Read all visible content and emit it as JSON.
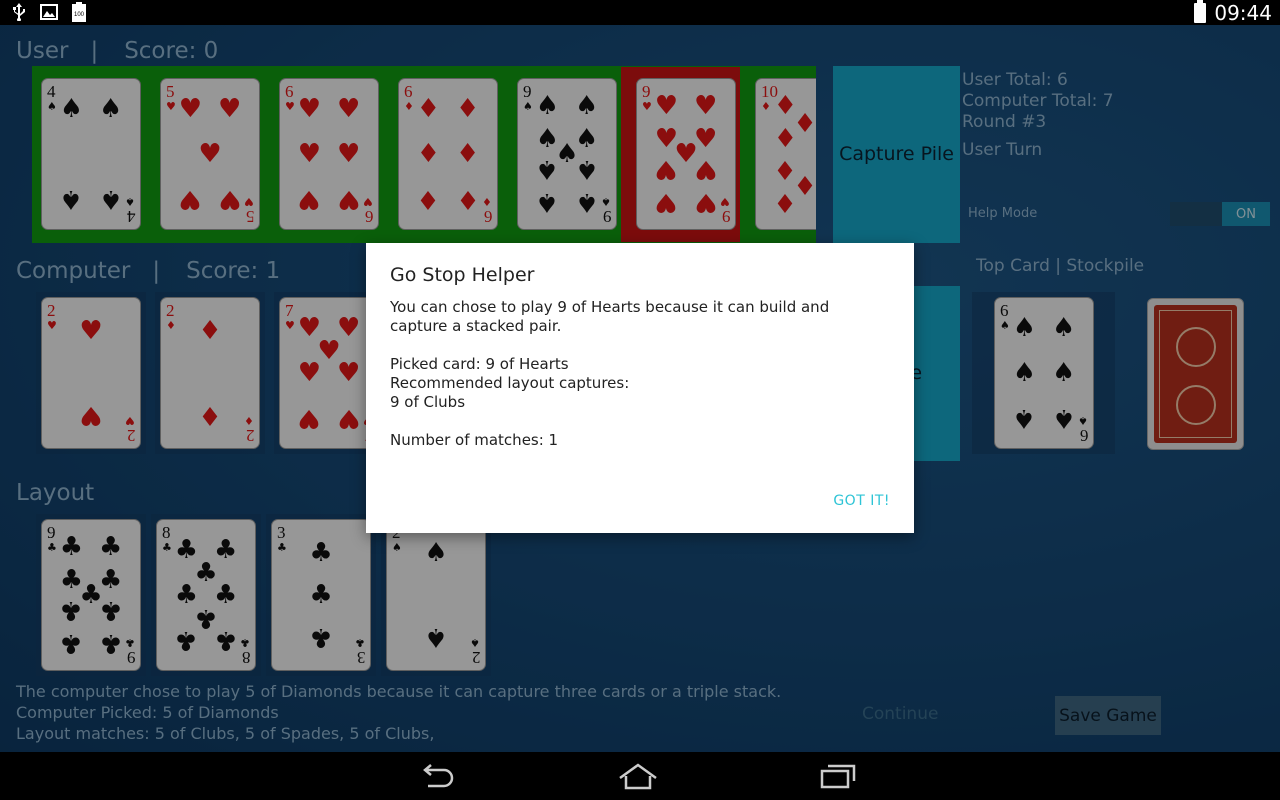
{
  "status_bar": {
    "time": "09:44",
    "icons": [
      "usb-icon",
      "image-icon",
      "battery-100-icon"
    ],
    "battery_label": "100"
  },
  "user": {
    "label": "User",
    "score_label": "Score: 0"
  },
  "computer": {
    "label": "Computer",
    "score_label": "Score: 1"
  },
  "layout_label": "Layout",
  "top_card_label": "Top Card | Stockpile",
  "capture_pile_label": "Capture Pile",
  "capture_pile_label_2": "re",
  "info": {
    "user_total": "User Total: 6",
    "computer_total": "Computer Total: 7",
    "round": "Round #3",
    "turn": "User Turn"
  },
  "help_mode": {
    "label": "Help Mode",
    "state": "ON"
  },
  "user_hand": [
    {
      "rank": "4",
      "suit": "spades"
    },
    {
      "rank": "5",
      "suit": "hearts"
    },
    {
      "rank": "6",
      "suit": "hearts"
    },
    {
      "rank": "6",
      "suit": "diamonds"
    },
    {
      "rank": "9",
      "suit": "spades"
    },
    {
      "rank": "9",
      "suit": "hearts",
      "selected": true
    },
    {
      "rank": "10",
      "suit": "diamonds"
    }
  ],
  "computer_hand": [
    {
      "rank": "2",
      "suit": "hearts"
    },
    {
      "rank": "2",
      "suit": "diamonds"
    },
    {
      "rank": "7",
      "suit": "hearts"
    }
  ],
  "layout_cards": [
    {
      "rank": "9",
      "suit": "clubs"
    },
    {
      "rank": "8",
      "suit": "clubs"
    },
    {
      "rank": "3",
      "suit": "clubs"
    },
    {
      "rank": "2",
      "suit": "spades"
    }
  ],
  "top_card": {
    "rank": "6",
    "suit": "spades"
  },
  "log": {
    "line1": "The computer chose to play 5 of Diamonds because it can capture three cards or a triple stack.",
    "line2": "Computer Picked: 5 of Diamonds",
    "line3": "Layout matches: 5 of Clubs, 5 of Spades, 5 of Clubs,"
  },
  "buttons": {
    "continue": "Continue",
    "save_game": "Save Game"
  },
  "dialog": {
    "title": "Go Stop Helper",
    "para1": "You can chose to play 9 of Hearts because it can build and capture a stacked pair.",
    "picked": "Picked card: 9 of Hearts",
    "recommended": "Recommended layout captures:",
    "capture_item": "9 of Clubs",
    "matches": "Number of matches: 1",
    "ok": "GOT IT!"
  },
  "nav": [
    "back-icon",
    "home-icon",
    "recents-icon"
  ],
  "colors": {
    "table_blue": "#164a77",
    "hand_green": "#119a11",
    "selected_red": "#c81414",
    "capture_cyan": "#16a6c9",
    "dialog_accent": "#2ec4d6"
  }
}
